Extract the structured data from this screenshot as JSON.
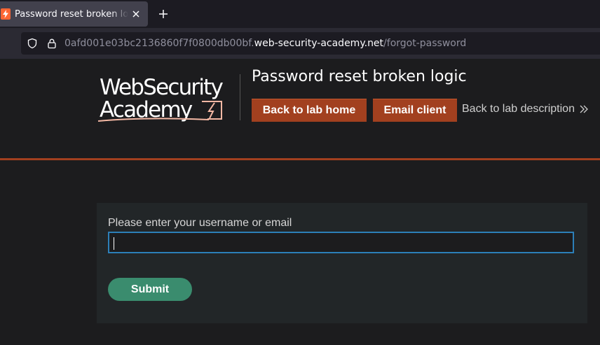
{
  "browser": {
    "tab": {
      "title": "Password reset broken logic"
    },
    "url": {
      "prefix": "0afd001e03bc2136860f7f0800db00bf.",
      "host": "web-security-academy.net",
      "path": "/forgot-password"
    }
  },
  "header": {
    "logo": {
      "line1": "WebSecurity",
      "line2": "Academy"
    },
    "lab_title": "Password reset broken logic",
    "back_button": "Back to lab home",
    "email_button": "Email client",
    "description_link": "Back to lab description"
  },
  "form": {
    "label": "Please enter your username or email",
    "input_value": "",
    "submit": "Submit"
  },
  "colors": {
    "accent_orange": "#a2401f",
    "submit_green": "#3a8c6e",
    "input_border": "#2c7fb8"
  }
}
